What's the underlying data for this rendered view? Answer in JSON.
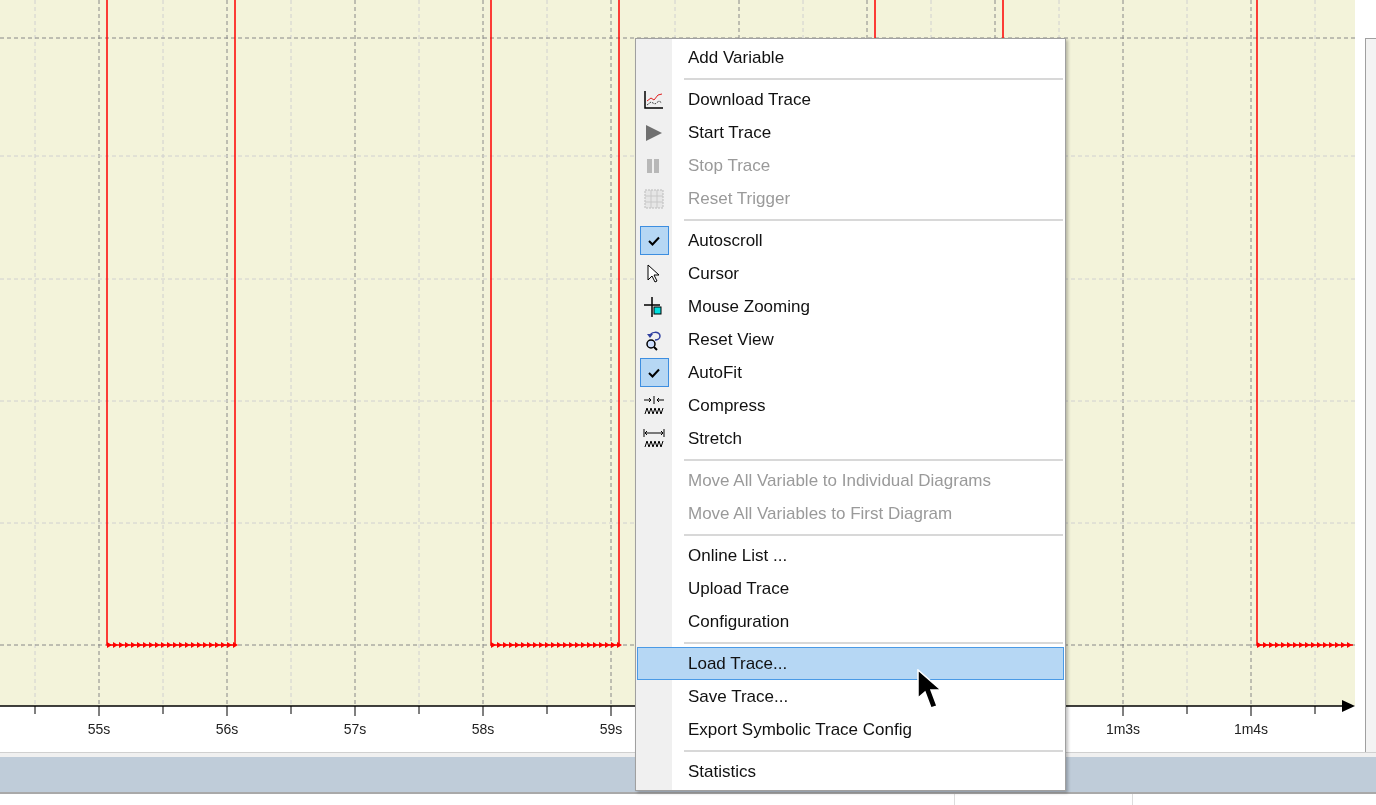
{
  "trace_plot": {
    "x_tick_labels": [
      "55s",
      "56s",
      "57s",
      "58s",
      "59s",
      "1m3s",
      "1m4s"
    ]
  },
  "context_menu": {
    "groups": [
      [
        {
          "label": "Add Variable",
          "disabled": false,
          "selected": false
        }
      ],
      [
        {
          "label": "Download Trace",
          "disabled": false,
          "selected": false
        },
        {
          "label": "Start Trace",
          "disabled": false,
          "selected": false
        },
        {
          "label": "Stop Trace",
          "disabled": true,
          "selected": false
        },
        {
          "label": "Reset Trigger",
          "disabled": true,
          "selected": false
        }
      ],
      [
        {
          "label": "Autoscroll",
          "disabled": false,
          "selected": false,
          "checked": true
        },
        {
          "label": "Cursor",
          "disabled": false,
          "selected": false,
          "checked": false
        },
        {
          "label": "Mouse Zooming",
          "disabled": false,
          "selected": false,
          "checked": false
        },
        {
          "label": "Reset View",
          "disabled": false,
          "selected": false,
          "checked": false
        },
        {
          "label": "AutoFit",
          "disabled": false,
          "selected": false,
          "checked": true
        },
        {
          "label": "Compress",
          "disabled": false,
          "selected": false,
          "checked": false
        },
        {
          "label": "Stretch",
          "disabled": false,
          "selected": false,
          "checked": false
        }
      ],
      [
        {
          "label": "Move All Variable to Individual Diagrams",
          "disabled": true,
          "selected": false
        },
        {
          "label": "Move All Variables to First Diagram",
          "disabled": true,
          "selected": false
        }
      ],
      [
        {
          "label": "Online List ...",
          "disabled": false,
          "selected": false
        },
        {
          "label": "Upload Trace",
          "disabled": false,
          "selected": false
        },
        {
          "label": "Configuration",
          "disabled": false,
          "selected": false
        }
      ],
      [
        {
          "label": "Load Trace...",
          "disabled": false,
          "selected": true
        },
        {
          "label": "Save Trace...",
          "disabled": false,
          "selected": false
        },
        {
          "label": "Export Symbolic Trace Config",
          "disabled": false,
          "selected": false
        }
      ],
      [
        {
          "label": "Statistics",
          "disabled": false,
          "selected": false
        }
      ]
    ]
  }
}
